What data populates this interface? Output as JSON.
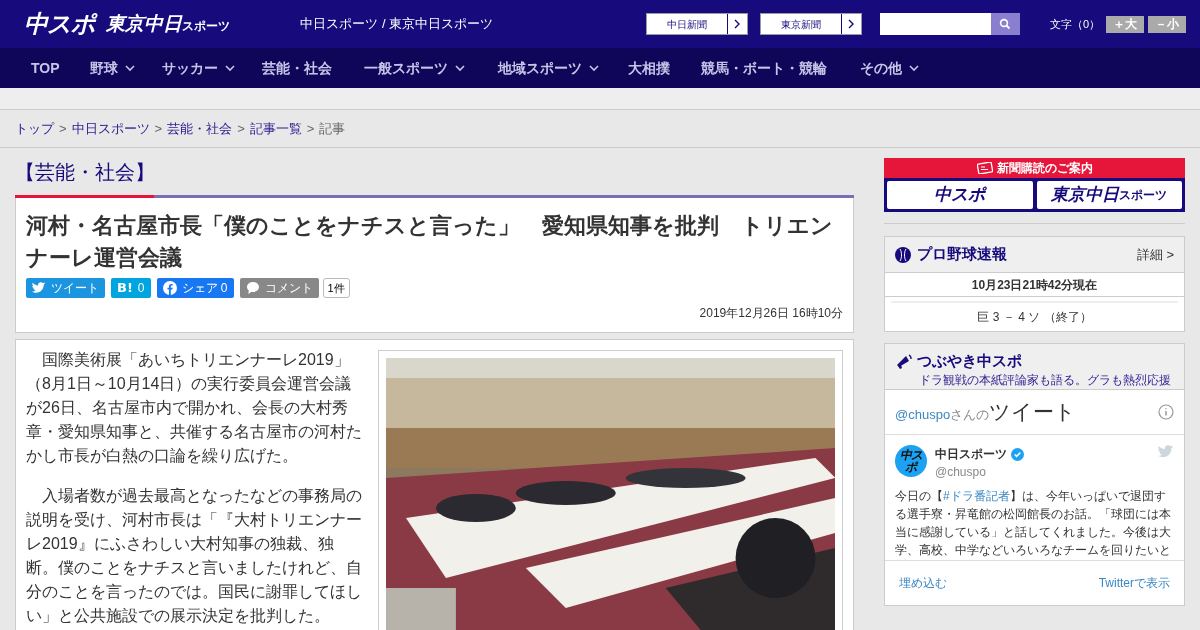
{
  "header": {
    "logo_main": "中スポ",
    "logo_tokyo": "東京中日",
    "logo_tokyo_small": "スポーツ",
    "site_names": "中日スポーツ / 東京中日スポーツ",
    "paper_links": [
      "中日新聞",
      "東京新聞"
    ],
    "font_size_label": "文字（0）",
    "font_buttons": [
      {
        "sign": "＋",
        "label": "大"
      },
      {
        "sign": "－",
        "label": "小"
      }
    ]
  },
  "nav": [
    {
      "label": "TOP",
      "dropdown": false
    },
    {
      "label": "野球",
      "dropdown": true
    },
    {
      "label": "サッカー",
      "dropdown": true
    },
    {
      "label": "芸能・社会",
      "dropdown": false
    },
    {
      "label": "一般スポーツ",
      "dropdown": true
    },
    {
      "label": "地域スポーツ",
      "dropdown": true
    },
    {
      "label": "大相撲",
      "dropdown": false
    },
    {
      "label": "競馬・ボート・競輪",
      "dropdown": false
    },
    {
      "label": "その他",
      "dropdown": true
    }
  ],
  "breadcrumb": [
    {
      "label": "トップ",
      "link": true
    },
    {
      "label": "中日スポーツ",
      "link": true,
      "separator": ">"
    },
    {
      "label": "芸能・社会",
      "link": true,
      "separator": ">"
    },
    {
      "label": "記事一覧",
      "link": true,
      "separator": ">"
    },
    {
      "label": "記事",
      "link": false,
      "separator": ">"
    }
  ],
  "section_title": "【芸能・社会】",
  "article": {
    "headline": "河村・名古屋市長「僕のことをナチスと言った」　愛知県知事を批判　トリエンナーレ運営会議",
    "share": [
      {
        "kind": "twitter",
        "label": "ツイート"
      },
      {
        "kind": "hatena",
        "icon_text": "B!",
        "label": "0"
      },
      {
        "kind": "facebook",
        "label": "シェア 0"
      },
      {
        "kind": "comment",
        "label": "コメント"
      }
    ],
    "comment_count": "1件",
    "date": "2019年12月26日 16時10分",
    "paragraphs": [
      "国際美術展「あいちトリエンナーレ2019」（8月1日～10月14日）の実行委員会運営会議が26日、名古屋市内で開かれ、会長の大村秀章・愛知県知事と、共催する名古屋市の河村たかし市長が白熱の口論を繰り広げた。",
      "入場者数が過去最高となったなどの事務局の説明を受け、河村市長は「『大村トリエンナーレ2019』にふさわしい大村知事の独裁、独断。僕のことをナチスと言いましたけれど、自分のことを言ったのでは。国民に謝罪してほしい」と公共施設での展示決定を批判した。"
    ]
  },
  "sidebar": {
    "subscribe": {
      "title": "新聞購読のご案内",
      "logos": [
        "中スポ",
        "東京中日"
      ],
      "logo_small": "スポーツ"
    },
    "baseball": {
      "title": "プロ野球速報",
      "more": "詳細 >",
      "updated": "10月23日21時42分現在",
      "score": "巨 3 － 4 ソ （終了）"
    },
    "tweets": {
      "title": "つぶやき中スポ",
      "subtitle": "ドラ観戦の本紙評論家も語る。グラも熱烈応援",
      "handle_prefix": "@chuspo",
      "handle_suffix": "さんの",
      "heading": "ツイート",
      "author": "中日スポーツ",
      "author_handle": "@chuspo",
      "avatar_text": "中スポ",
      "text_before": "今日の【",
      "hashtag": "#ドラ番記者",
      "text_after": "】は、今年いっぱいで退団する選手寮・昇竜館の松岡館長のお話。「球団には本当に感謝している」と話してくれました。今後は大学、高校、中学などいろいろなチームを回りたいと",
      "embed": "埋め込む",
      "view": "Twitterで表示"
    }
  }
}
